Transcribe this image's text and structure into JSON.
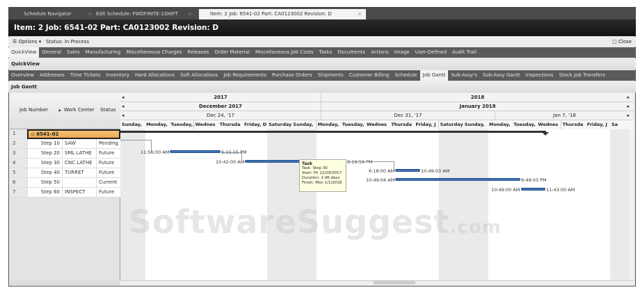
{
  "doc_tabs": [
    {
      "label": "Schedule Navigator"
    },
    {
      "label": "Edit Schedule: FWDFINITE-1SHIFT"
    },
    {
      "label": "Item: 2 Job: 6541-02 Part: CA0123002 Revision: D"
    }
  ],
  "close_glyph": "×",
  "title": "Item: 2 Job: 6541-02 Part: CA0123002 Revision: D",
  "options_label": "Options",
  "status": "Status: In Process",
  "close_label": "Close",
  "main_tabs": [
    "QuickView",
    "General",
    "Sales",
    "Manufacturing",
    "Miscellaneous Charges",
    "Releases",
    "Order Material",
    "Miscellaneous Job Costs",
    "Tasks",
    "Documents",
    "Actions",
    "Image",
    "User-Defined",
    "Audit Trail"
  ],
  "section_label": "QuickView",
  "sub_tabs": [
    "Overview",
    "Addresses",
    "Time Tickets",
    "Inventory",
    "Hard Allocations",
    "Soft Allocations",
    "Job Requirements",
    "Purchase Orders",
    "Shipments",
    "Customer Billing",
    "Schedule",
    "Job Gantt",
    "Sub-Assy's",
    "Sub-Assy Gantt",
    "Inspections",
    "Stock Job Transfers"
  ],
  "panel_label": "Job Gantt",
  "grid": {
    "headers": {
      "job": "Job Number",
      "wc": "Work Center",
      "status": "Status"
    },
    "group": {
      "num": "1",
      "job": "6541-02"
    },
    "rows": [
      {
        "num": "2",
        "step": "Step 10",
        "wc": "SAW",
        "status": "Pending"
      },
      {
        "num": "3",
        "step": "Step 20",
        "wc": "SML LATHE",
        "status": "Future"
      },
      {
        "num": "4",
        "step": "Step 30",
        "wc": "CNC LATHE",
        "status": "Future"
      },
      {
        "num": "5",
        "step": "Step 40",
        "wc": "TURRET",
        "status": "Future"
      },
      {
        "num": "6",
        "step": "Step 50",
        "wc": "",
        "status": "Current"
      },
      {
        "num": "7",
        "step": "Step 60",
        "wc": "INSPECT",
        "status": "Future"
      }
    ]
  },
  "gantt": {
    "years": [
      "2017",
      "2018"
    ],
    "months": [
      "December 2017",
      "January 2018"
    ],
    "weeks": [
      "Dec 24, '17",
      "Dec 31, '17",
      "Jan 7, '18"
    ],
    "days": [
      "Sunday,",
      "Monday,",
      "Tuesday,",
      "Wednes",
      "Thursda",
      "Friday, D",
      "Saturday",
      "Sunday,",
      "Monday,",
      "Tuesday,",
      "Wednes",
      "Thursda",
      "Friday, J",
      "Saturday",
      "Sunday,",
      "Monday,",
      "Tuesday,",
      "Wednes",
      "Thursda",
      "Friday, J",
      "Sa"
    ],
    "labels": [
      "11:56:00 AM",
      "6:15:15 PM",
      "10:42:00 AM",
      "8:19:59 PM",
      "6:18:00 AM",
      "10:49:03 AM",
      "10:49:04 AM",
      "9:49:03 PM",
      "10:49:00 AM",
      "11:43:00 AM"
    ],
    "tooltip": {
      "title": "Task",
      "task": "Task: Step 30",
      "start": "Start: Fri 12/29/2017",
      "duration": "Duration: 2.96 days",
      "finish": "Finish: Mon 1/1/2018"
    }
  },
  "watermark": "SoftwareSuggest",
  "watermark_suffix": ".com"
}
